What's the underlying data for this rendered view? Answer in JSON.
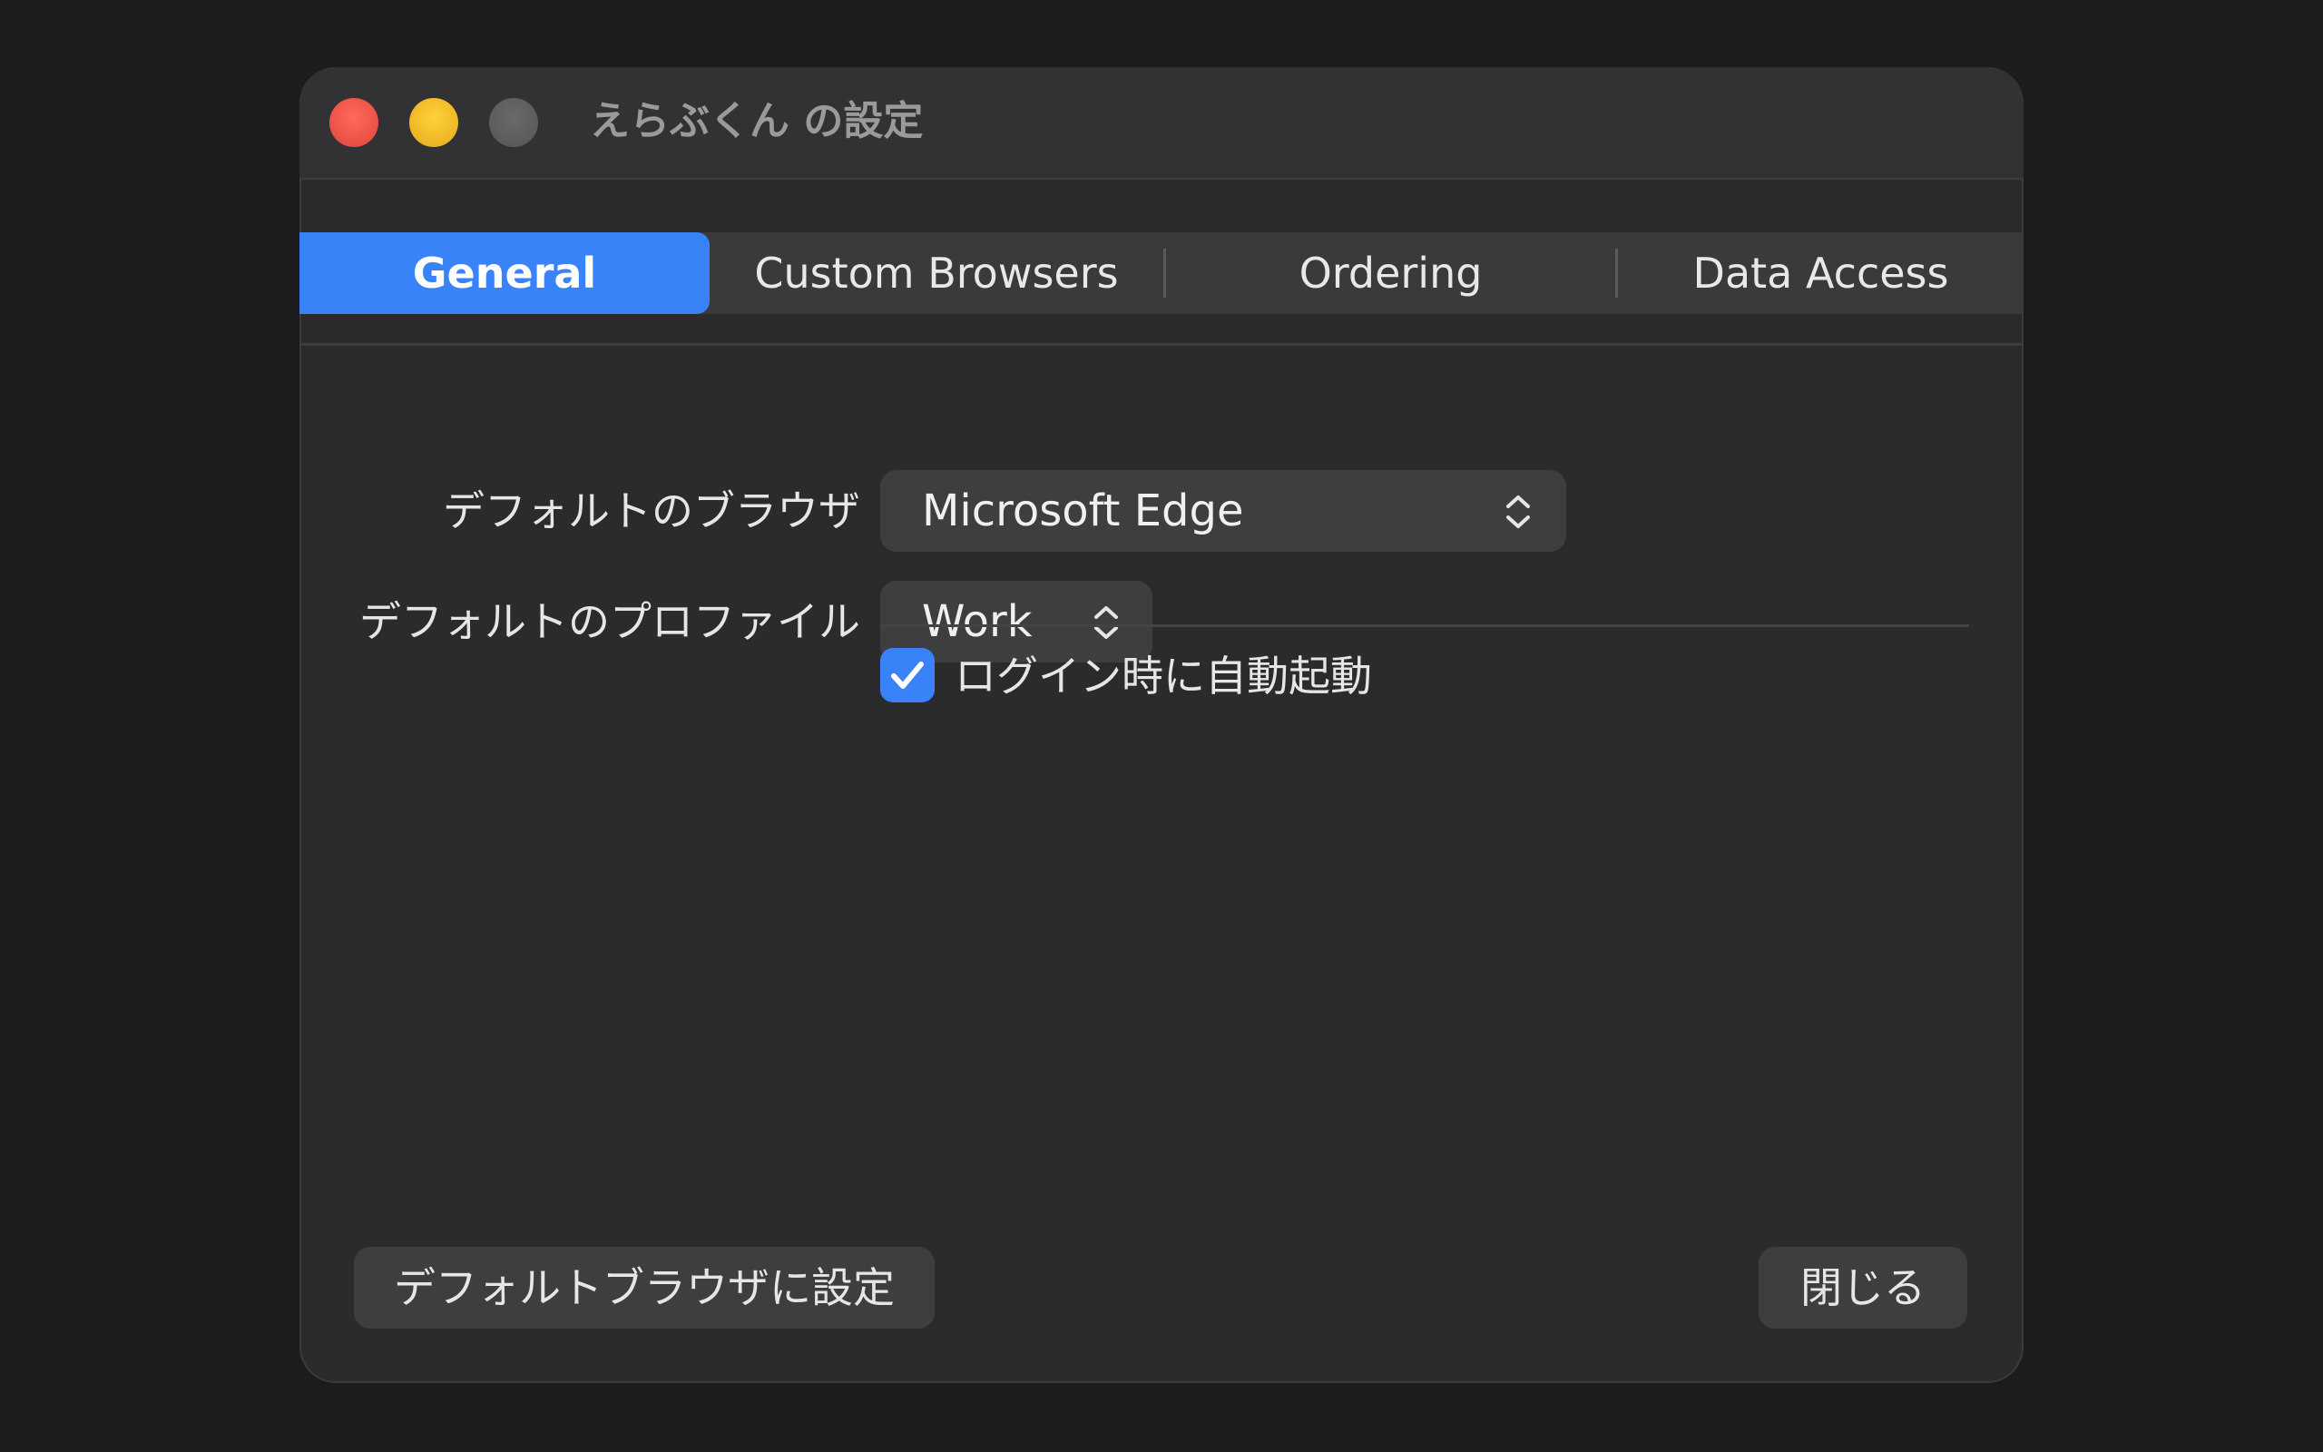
{
  "window": {
    "title": "えらぶくん の設定"
  },
  "tabs": [
    {
      "label": "General",
      "selected": true
    },
    {
      "label": "Custom Browsers",
      "selected": false
    },
    {
      "label": "Ordering",
      "selected": false
    },
    {
      "label": "Data Access",
      "selected": false
    }
  ],
  "settings": {
    "default_browser_label": "デフォルトのブラウザ",
    "default_browser_value": "Microsoft Edge",
    "default_profile_label": "デフォルトのプロファイル",
    "default_profile_value": "Work",
    "launch_at_login_label": "ログイン時に自動起動",
    "launch_at_login_checked": true
  },
  "buttons": {
    "set_default_label": "デフォルトブラウザに設定",
    "close_label": "閉じる"
  },
  "colors": {
    "accent": "#3a82f7",
    "close": "#ff5f57",
    "minimize": "#febc2e",
    "zoom_disabled": "#5e5e60"
  }
}
